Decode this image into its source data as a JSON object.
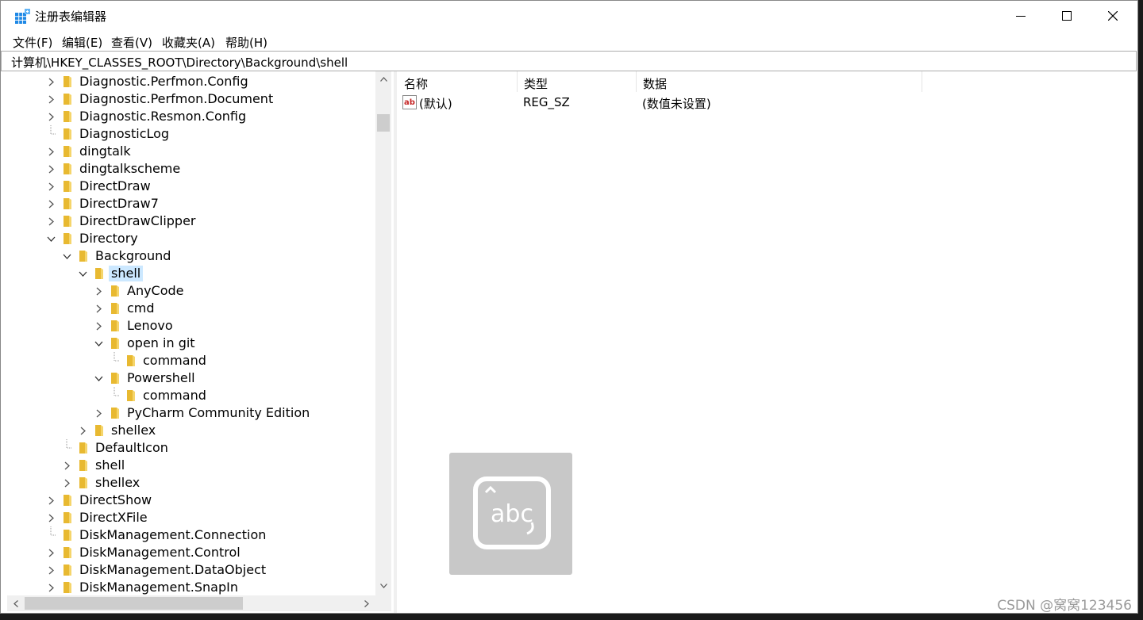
{
  "window": {
    "title": "注册表编辑器"
  },
  "menu": [
    "文件(F)",
    "编辑(E)",
    "查看(V)",
    "收藏夹(A)",
    "帮助(H)"
  ],
  "address": "计算机\\HKEY_CLASSES_ROOT\\Directory\\Background\\shell",
  "tree": [
    {
      "label": "Diagnostic.Perfmon.Config",
      "level": 0,
      "expander": "collapsed"
    },
    {
      "label": "Diagnostic.Perfmon.Document",
      "level": 0,
      "expander": "collapsed"
    },
    {
      "label": "Diagnostic.Resmon.Config",
      "level": 0,
      "expander": "collapsed"
    },
    {
      "label": "DiagnosticLog",
      "level": 0,
      "expander": "none"
    },
    {
      "label": "dingtalk",
      "level": 0,
      "expander": "collapsed"
    },
    {
      "label": "dingtalkscheme",
      "level": 0,
      "expander": "collapsed"
    },
    {
      "label": "DirectDraw",
      "level": 0,
      "expander": "collapsed"
    },
    {
      "label": "DirectDraw7",
      "level": 0,
      "expander": "collapsed"
    },
    {
      "label": "DirectDrawClipper",
      "level": 0,
      "expander": "collapsed"
    },
    {
      "label": "Directory",
      "level": 0,
      "expander": "expanded"
    },
    {
      "label": "Background",
      "level": 1,
      "expander": "expanded"
    },
    {
      "label": "shell",
      "level": 2,
      "expander": "expanded",
      "selected": true
    },
    {
      "label": "AnyCode",
      "level": 3,
      "expander": "collapsed"
    },
    {
      "label": "cmd",
      "level": 3,
      "expander": "collapsed"
    },
    {
      "label": "Lenovo",
      "level": 3,
      "expander": "collapsed"
    },
    {
      "label": "open in git",
      "level": 3,
      "expander": "expanded"
    },
    {
      "label": "command",
      "level": 4,
      "expander": "none"
    },
    {
      "label": "Powershell",
      "level": 3,
      "expander": "expanded"
    },
    {
      "label": "command",
      "level": 4,
      "expander": "none"
    },
    {
      "label": "PyCharm Community Edition",
      "level": 3,
      "expander": "collapsed"
    },
    {
      "label": "shellex",
      "level": 2,
      "expander": "collapsed"
    },
    {
      "label": "DefaultIcon",
      "level": 1,
      "expander": "none"
    },
    {
      "label": "shell",
      "level": 1,
      "expander": "collapsed"
    },
    {
      "label": "shellex",
      "level": 1,
      "expander": "collapsed"
    },
    {
      "label": "DirectShow",
      "level": 0,
      "expander": "collapsed"
    },
    {
      "label": "DirectXFile",
      "level": 0,
      "expander": "collapsed"
    },
    {
      "label": "DiskManagement.Connection",
      "level": 0,
      "expander": "none"
    },
    {
      "label": "DiskManagement.Control",
      "level": 0,
      "expander": "collapsed"
    },
    {
      "label": "DiskManagement.DataObject",
      "level": 0,
      "expander": "collapsed"
    },
    {
      "label": "DiskManagement.SnapIn",
      "level": 0,
      "expander": "collapsed"
    }
  ],
  "columns": {
    "name": "名称",
    "type": "类型",
    "data": "数据"
  },
  "values": [
    {
      "name": "(默认)",
      "type": "REG_SZ",
      "data": "(数值未设置)",
      "icon": "string-value-icon"
    }
  ],
  "overlay": {
    "text": "abc",
    "icon": "keyboard-abc-icon"
  },
  "watermark": "CSDN @窝窝123456",
  "colors": {
    "folder": "#e8b931",
    "selection": "#cce8ff",
    "accent": "#0078d7"
  }
}
